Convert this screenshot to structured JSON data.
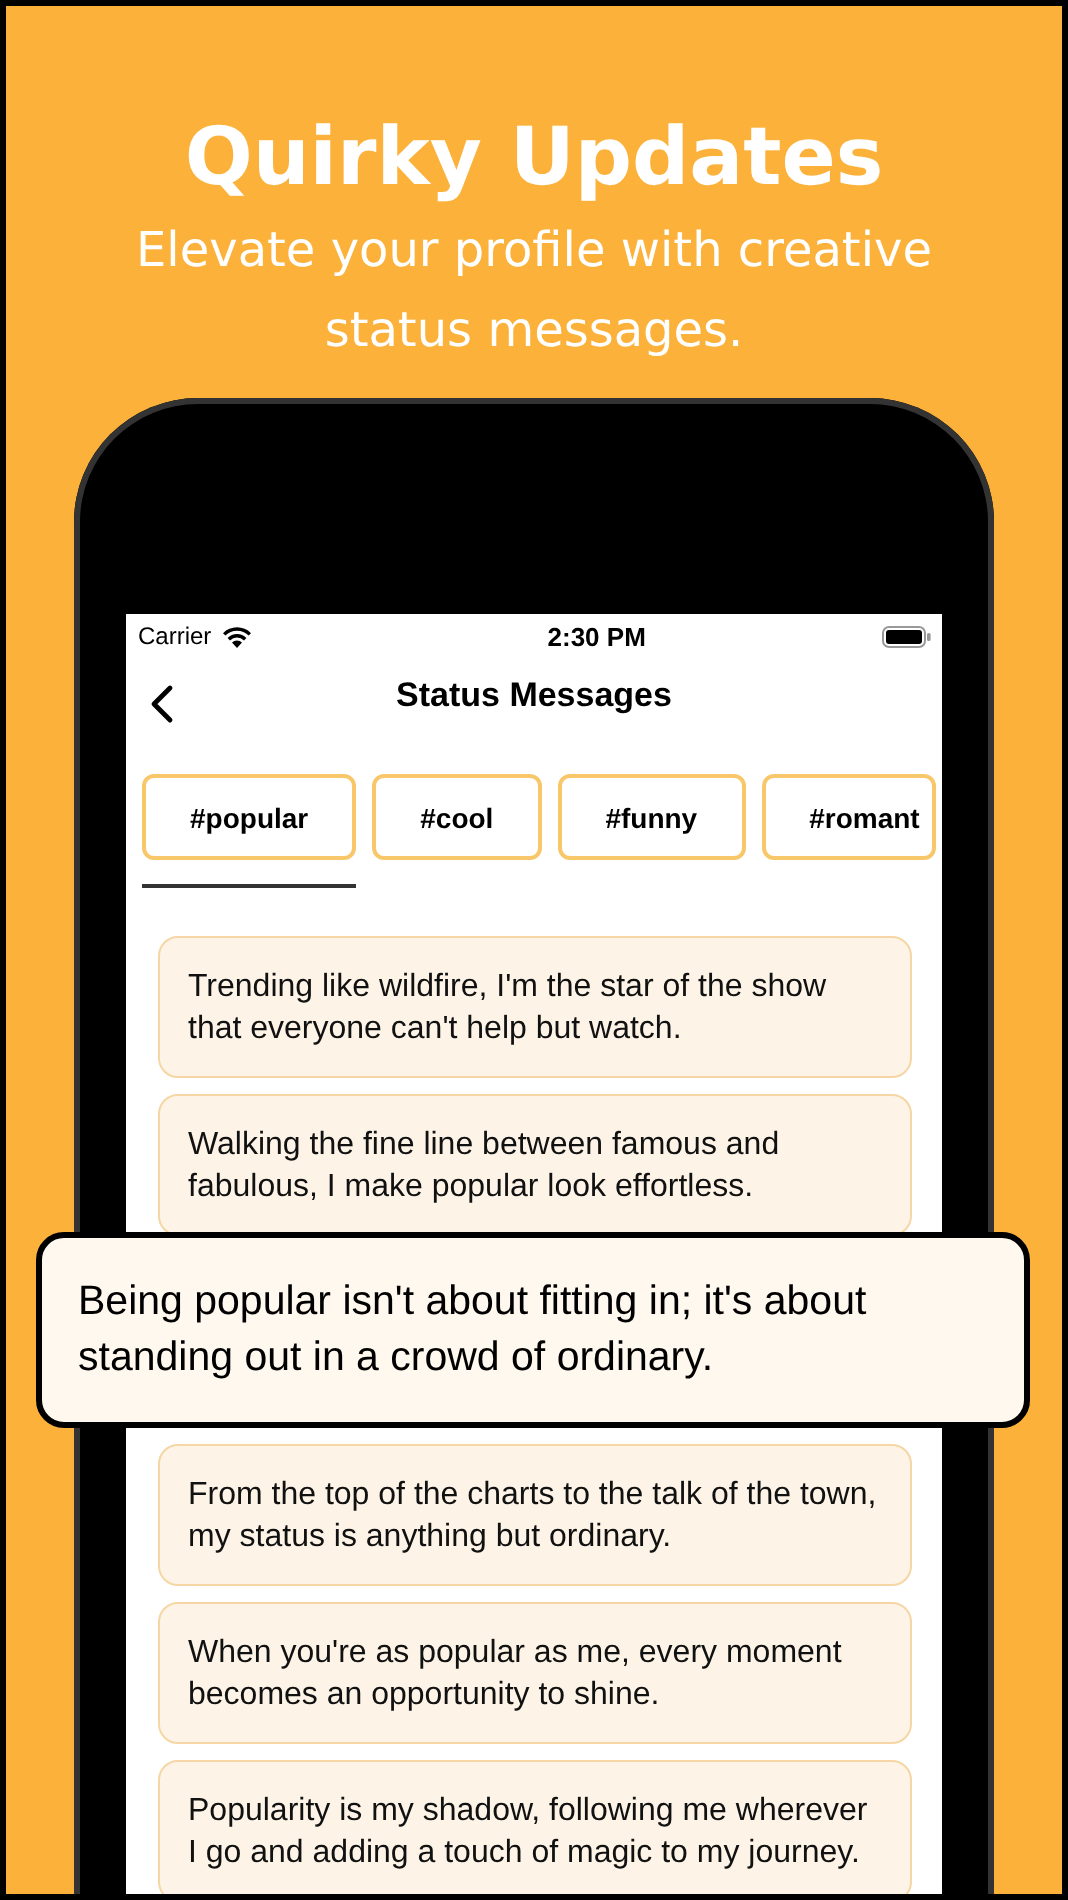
{
  "headline": "Quirky Updates",
  "subtitle": "Elevate your profile with creative status messages.",
  "status_bar": {
    "carrier": "Carrier",
    "time": "2:30 PM"
  },
  "nav": {
    "title": "Status Messages"
  },
  "tabs": [
    {
      "label": "#popular",
      "selected": true
    },
    {
      "label": "#cool",
      "selected": false
    },
    {
      "label": "#funny",
      "selected": false
    },
    {
      "label": "#romant",
      "selected": false
    }
  ],
  "messages": [
    {
      "kind": "card",
      "text": "Trending like wildfire, I'm the star of the show that everyone can't help but watch."
    },
    {
      "kind": "card",
      "text": "Walking the fine line between famous and fabulous, I make popular look effortless."
    },
    {
      "kind": "featured",
      "text": "Being popular isn't about fitting in; it's about standing out in a crowd of ordinary."
    },
    {
      "kind": "card",
      "text": "From the top of the charts to the talk of the town, my status is anything but ordinary."
    },
    {
      "kind": "card",
      "text": "When you're as popular as me, every moment becomes an opportunity to shine."
    },
    {
      "kind": "card",
      "text": "Popularity is my shadow, following me wherever I go and adding a touch of magic to my journey."
    }
  ]
}
